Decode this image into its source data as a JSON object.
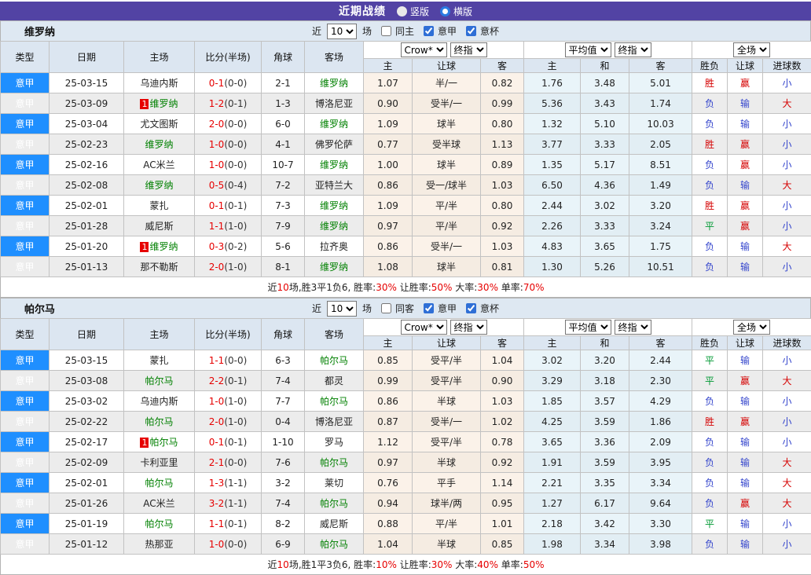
{
  "topbar": {
    "title": "近期战绩",
    "radio_vertical": "竖版",
    "radio_horizontal": "横版",
    "selected": "横版"
  },
  "table_header": {
    "static_cols": [
      "类型",
      "日期",
      "主场",
      "比分(半场)",
      "角球",
      "客场"
    ],
    "crow_select": "Crow*",
    "crow_final_select": "终指",
    "avg_select": "平均值",
    "avg_final_select": "终指",
    "full_select": "全场",
    "crow_sub": [
      "主",
      "让球",
      "客"
    ],
    "avg_sub": [
      "主",
      "和",
      "客"
    ],
    "result_sub": [
      "胜负",
      "让球",
      "进球数"
    ]
  },
  "colors": {
    "topbar_purple": "#5243a4",
    "type_cell_blue": "#1f8fff",
    "focus_team_green": "#008000",
    "score_red": "#e60000",
    "badge_red": "#e60000",
    "result_red": "#d50000",
    "result_green": "#009933",
    "result_blue": "#3344cc",
    "crow_bg": "#fbf2e9",
    "avg_bg": "#e9f4f9",
    "header_bg": "#dce6f1",
    "section_bg": "#dee8f2",
    "row_alt": "#ececec"
  },
  "result_color_map": {
    "胜": "r",
    "平": "g",
    "负": "b",
    "赢": "r",
    "输": "b",
    "大": "r",
    "小": "b"
  },
  "sections": [
    {
      "team": "维罗纳",
      "filters": {
        "near": "近",
        "games": "10",
        "games_suffix": "场",
        "same_label": "同主",
        "same_checked": false,
        "league_label": "意甲",
        "league_checked": true,
        "cup_label": "意杯",
        "cup_checked": true
      },
      "rows": [
        {
          "league": "意甲",
          "date": "25-03-15",
          "home": "乌迪内斯",
          "home_badge": "",
          "home_focus": false,
          "score": "0-1",
          "half": "(0-0)",
          "corner": "2-1",
          "away": "维罗纳",
          "away_focus": true,
          "crow": [
            "1.07",
            "半/一",
            "0.82"
          ],
          "avg": [
            "1.76",
            "3.48",
            "5.01"
          ],
          "result": [
            "胜",
            "赢",
            "小"
          ]
        },
        {
          "league": "意甲",
          "date": "25-03-09",
          "home": "维罗纳",
          "home_badge": "1",
          "home_focus": true,
          "score": "1-2",
          "half": "(0-1)",
          "corner": "1-3",
          "away": "博洛尼亚",
          "away_focus": false,
          "crow": [
            "0.90",
            "受半/一",
            "0.99"
          ],
          "avg": [
            "5.36",
            "3.43",
            "1.74"
          ],
          "result": [
            "负",
            "输",
            "大"
          ]
        },
        {
          "league": "意甲",
          "date": "25-03-04",
          "home": "尤文图斯",
          "home_badge": "",
          "home_focus": false,
          "score": "2-0",
          "half": "(0-0)",
          "corner": "6-0",
          "away": "维罗纳",
          "away_focus": true,
          "crow": [
            "1.09",
            "球半",
            "0.80"
          ],
          "avg": [
            "1.32",
            "5.10",
            "10.03"
          ],
          "result": [
            "负",
            "输",
            "小"
          ]
        },
        {
          "league": "意甲",
          "date": "25-02-23",
          "home": "维罗纳",
          "home_badge": "",
          "home_focus": true,
          "score": "1-0",
          "half": "(0-0)",
          "corner": "4-1",
          "away": "佛罗伦萨",
          "away_focus": false,
          "crow": [
            "0.77",
            "受半球",
            "1.13"
          ],
          "avg": [
            "3.77",
            "3.33",
            "2.05"
          ],
          "result": [
            "胜",
            "赢",
            "小"
          ]
        },
        {
          "league": "意甲",
          "date": "25-02-16",
          "home": "AC米兰",
          "home_badge": "",
          "home_focus": false,
          "score": "1-0",
          "half": "(0-0)",
          "corner": "10-7",
          "away": "维罗纳",
          "away_focus": true,
          "crow": [
            "1.00",
            "球半",
            "0.89"
          ],
          "avg": [
            "1.35",
            "5.17",
            "8.51"
          ],
          "result": [
            "负",
            "赢",
            "小"
          ]
        },
        {
          "league": "意甲",
          "date": "25-02-08",
          "home": "维罗纳",
          "home_badge": "",
          "home_focus": true,
          "score": "0-5",
          "half": "(0-4)",
          "corner": "7-2",
          "away": "亚特兰大",
          "away_focus": false,
          "crow": [
            "0.86",
            "受一/球半",
            "1.03"
          ],
          "avg": [
            "6.50",
            "4.36",
            "1.49"
          ],
          "result": [
            "负",
            "输",
            "大"
          ]
        },
        {
          "league": "意甲",
          "date": "25-02-01",
          "home": "蒙扎",
          "home_badge": "",
          "home_focus": false,
          "score": "0-1",
          "half": "(0-1)",
          "corner": "7-3",
          "away": "维罗纳",
          "away_focus": true,
          "crow": [
            "1.09",
            "平/半",
            "0.80"
          ],
          "avg": [
            "2.44",
            "3.02",
            "3.20"
          ],
          "result": [
            "胜",
            "赢",
            "小"
          ]
        },
        {
          "league": "意甲",
          "date": "25-01-28",
          "home": "威尼斯",
          "home_badge": "",
          "home_focus": false,
          "score": "1-1",
          "half": "(1-0)",
          "corner": "7-9",
          "away": "维罗纳",
          "away_focus": true,
          "crow": [
            "0.97",
            "平/半",
            "0.92"
          ],
          "avg": [
            "2.26",
            "3.33",
            "3.24"
          ],
          "result": [
            "平",
            "赢",
            "小"
          ]
        },
        {
          "league": "意甲",
          "date": "25-01-20",
          "home": "维罗纳",
          "home_badge": "1",
          "home_focus": true,
          "score": "0-3",
          "half": "(0-2)",
          "corner": "5-6",
          "away": "拉齐奥",
          "away_focus": false,
          "crow": [
            "0.86",
            "受半/一",
            "1.03"
          ],
          "avg": [
            "4.83",
            "3.65",
            "1.75"
          ],
          "result": [
            "负",
            "输",
            "大"
          ]
        },
        {
          "league": "意甲",
          "date": "25-01-13",
          "home": "那不勒斯",
          "home_badge": "",
          "home_focus": false,
          "score": "2-0",
          "half": "(1-0)",
          "corner": "8-1",
          "away": "维罗纳",
          "away_focus": true,
          "crow": [
            "1.08",
            "球半",
            "0.81"
          ],
          "avg": [
            "1.30",
            "5.26",
            "10.51"
          ],
          "result": [
            "负",
            "输",
            "小"
          ]
        }
      ],
      "summary_parts": [
        {
          "text": "近",
          "red": false
        },
        {
          "text": "10",
          "red": true
        },
        {
          "text": "场,胜3平1负6, 胜率:",
          "red": false
        },
        {
          "text": "30%",
          "red": true
        },
        {
          "text": " 让胜率:",
          "red": false
        },
        {
          "text": "50%",
          "red": true
        },
        {
          "text": " 大率:",
          "red": false
        },
        {
          "text": "30%",
          "red": true
        },
        {
          "text": " 单率:",
          "red": false
        },
        {
          "text": "70%",
          "red": true
        }
      ]
    },
    {
      "team": "帕尔马",
      "filters": {
        "near": "近",
        "games": "10",
        "games_suffix": "场",
        "same_label": "同客",
        "same_checked": false,
        "league_label": "意甲",
        "league_checked": true,
        "cup_label": "意杯",
        "cup_checked": true
      },
      "rows": [
        {
          "league": "意甲",
          "date": "25-03-15",
          "home": "蒙扎",
          "home_badge": "",
          "home_focus": false,
          "score": "1-1",
          "half": "(0-0)",
          "corner": "6-3",
          "away": "帕尔马",
          "away_focus": true,
          "crow": [
            "0.85",
            "受平/半",
            "1.04"
          ],
          "avg": [
            "3.02",
            "3.20",
            "2.44"
          ],
          "result": [
            "平",
            "输",
            "小"
          ]
        },
        {
          "league": "意甲",
          "date": "25-03-08",
          "home": "帕尔马",
          "home_badge": "",
          "home_focus": true,
          "score": "2-2",
          "half": "(0-1)",
          "corner": "7-4",
          "away": "都灵",
          "away_focus": false,
          "crow": [
            "0.99",
            "受平/半",
            "0.90"
          ],
          "avg": [
            "3.29",
            "3.18",
            "2.30"
          ],
          "result": [
            "平",
            "赢",
            "大"
          ]
        },
        {
          "league": "意甲",
          "date": "25-03-02",
          "home": "乌迪内斯",
          "home_badge": "",
          "home_focus": false,
          "score": "1-0",
          "half": "(1-0)",
          "corner": "7-7",
          "away": "帕尔马",
          "away_focus": true,
          "crow": [
            "0.86",
            "半球",
            "1.03"
          ],
          "avg": [
            "1.85",
            "3.57",
            "4.29"
          ],
          "result": [
            "负",
            "输",
            "小"
          ]
        },
        {
          "league": "意甲",
          "date": "25-02-22",
          "home": "帕尔马",
          "home_badge": "",
          "home_focus": true,
          "score": "2-0",
          "half": "(1-0)",
          "corner": "0-4",
          "away": "博洛尼亚",
          "away_focus": false,
          "crow": [
            "0.87",
            "受半/一",
            "1.02"
          ],
          "avg": [
            "4.25",
            "3.59",
            "1.86"
          ],
          "result": [
            "胜",
            "赢",
            "小"
          ]
        },
        {
          "league": "意甲",
          "date": "25-02-17",
          "home": "帕尔马",
          "home_badge": "1",
          "home_focus": true,
          "score": "0-1",
          "half": "(0-1)",
          "corner": "1-10",
          "away": "罗马",
          "away_focus": false,
          "crow": [
            "1.12",
            "受平/半",
            "0.78"
          ],
          "avg": [
            "3.65",
            "3.36",
            "2.09"
          ],
          "result": [
            "负",
            "输",
            "小"
          ]
        },
        {
          "league": "意甲",
          "date": "25-02-09",
          "home": "卡利亚里",
          "home_badge": "",
          "home_focus": false,
          "score": "2-1",
          "half": "(0-0)",
          "corner": "7-6",
          "away": "帕尔马",
          "away_focus": true,
          "crow": [
            "0.97",
            "半球",
            "0.92"
          ],
          "avg": [
            "1.91",
            "3.59",
            "3.95"
          ],
          "result": [
            "负",
            "输",
            "大"
          ]
        },
        {
          "league": "意甲",
          "date": "25-02-01",
          "home": "帕尔马",
          "home_badge": "",
          "home_focus": true,
          "score": "1-3",
          "half": "(1-1)",
          "corner": "3-2",
          "away": "莱切",
          "away_focus": false,
          "crow": [
            "0.76",
            "平手",
            "1.14"
          ],
          "avg": [
            "2.21",
            "3.35",
            "3.34"
          ],
          "result": [
            "负",
            "输",
            "大"
          ]
        },
        {
          "league": "意甲",
          "date": "25-01-26",
          "home": "AC米兰",
          "home_badge": "",
          "home_focus": false,
          "score": "3-2",
          "half": "(1-1)",
          "corner": "7-4",
          "away": "帕尔马",
          "away_focus": true,
          "crow": [
            "0.94",
            "球半/两",
            "0.95"
          ],
          "avg": [
            "1.27",
            "6.17",
            "9.64"
          ],
          "result": [
            "负",
            "赢",
            "大"
          ]
        },
        {
          "league": "意甲",
          "date": "25-01-19",
          "home": "帕尔马",
          "home_badge": "",
          "home_focus": true,
          "score": "1-1",
          "half": "(0-1)",
          "corner": "8-2",
          "away": "威尼斯",
          "away_focus": false,
          "crow": [
            "0.88",
            "平/半",
            "1.01"
          ],
          "avg": [
            "2.18",
            "3.42",
            "3.30"
          ],
          "result": [
            "平",
            "输",
            "小"
          ]
        },
        {
          "league": "意甲",
          "date": "25-01-12",
          "home": "热那亚",
          "home_badge": "",
          "home_focus": false,
          "score": "1-0",
          "half": "(0-0)",
          "corner": "6-9",
          "away": "帕尔马",
          "away_focus": true,
          "crow": [
            "1.04",
            "半球",
            "0.85"
          ],
          "avg": [
            "1.98",
            "3.34",
            "3.98"
          ],
          "result": [
            "负",
            "输",
            "小"
          ]
        }
      ],
      "summary_parts": [
        {
          "text": "近",
          "red": false
        },
        {
          "text": "10",
          "red": true
        },
        {
          "text": "场,胜1平3负6, 胜率:",
          "red": false
        },
        {
          "text": "10%",
          "red": true
        },
        {
          "text": " 让胜率:",
          "red": false
        },
        {
          "text": "30%",
          "red": true
        },
        {
          "text": " 大率:",
          "red": false
        },
        {
          "text": "40%",
          "red": true
        },
        {
          "text": " 单率:",
          "red": false
        },
        {
          "text": "50%",
          "red": true
        }
      ]
    }
  ]
}
